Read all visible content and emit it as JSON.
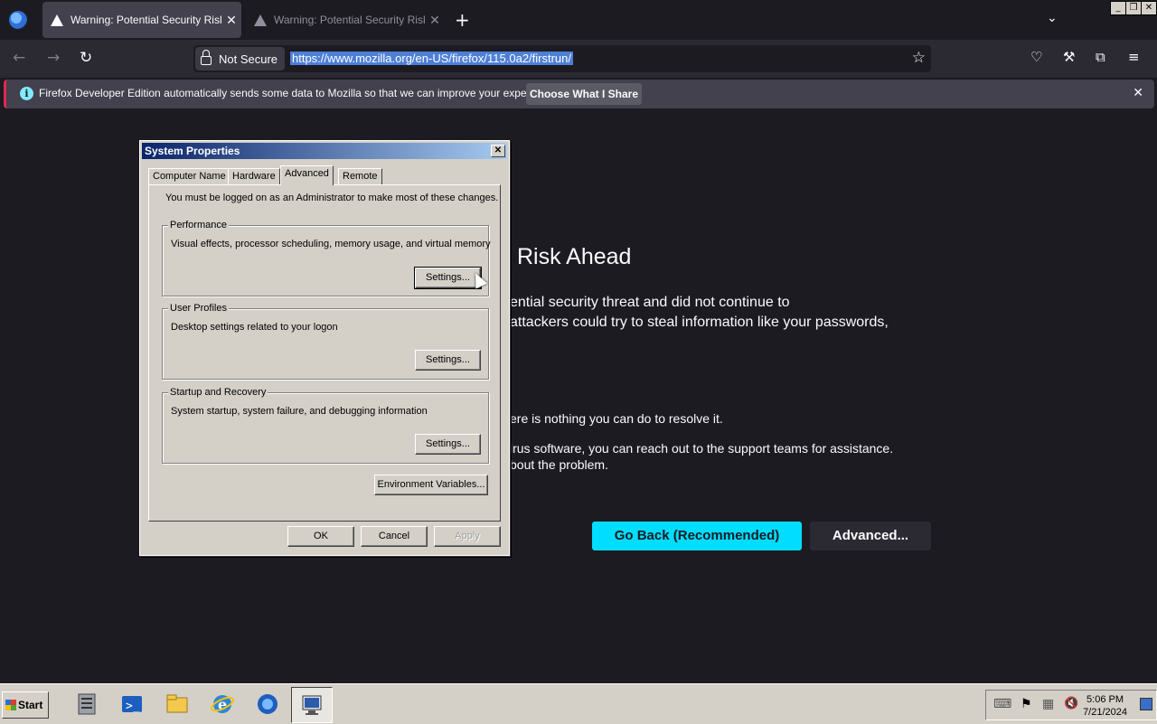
{
  "browser": {
    "tabs": [
      {
        "title": "Warning: Potential Security Risk Ah"
      },
      {
        "title": "Warning: Potential Security Risk Ah"
      }
    ],
    "security_label": "Not Secure",
    "url": "https://www.mozilla.org/en-US/firefox/115.0a2/firstrun/",
    "window_controls": {
      "minimize": "_",
      "restore": "❒",
      "close": "✕"
    }
  },
  "infobar": {
    "text": "Firefox Developer Edition automatically sends some data to Mozilla so that we can improve your experience.",
    "button": "Choose What I Share"
  },
  "page": {
    "heading": "Risk Ahead",
    "para1_line1": "ential security threat and did not continue to",
    "para1_line2": "attackers could try to steal information like your passwords,",
    "para2": "ere is nothing you can do to resolve it.",
    "para3_line1": "irus software, you can reach out to the support teams for assistance.",
    "para3_line2": "bout the problem.",
    "go_back": "Go Back (Recommended)",
    "advanced": "Advanced..."
  },
  "dialog": {
    "title": "System Properties",
    "tabs": [
      "Computer Name",
      "Hardware",
      "Advanced",
      "Remote"
    ],
    "selected_tab": "Advanced",
    "admin_note": "You must be logged on as an Administrator to make most of these changes.",
    "groups": [
      {
        "label": "Performance",
        "desc": "Visual effects, processor scheduling, memory usage, and virtual memory",
        "button": "Settings..."
      },
      {
        "label": "User Profiles",
        "desc": "Desktop settings related to your logon",
        "button": "Settings..."
      },
      {
        "label": "Startup and Recovery",
        "desc": "System startup, system failure, and debugging information",
        "button": "Settings..."
      }
    ],
    "env_button": "Environment Variables...",
    "ok": "OK",
    "cancel": "Cancel",
    "apply": "Apply"
  },
  "taskbar": {
    "start": "Start",
    "quick_launch": [
      "server-manager-icon",
      "powershell-icon",
      "explorer-icon",
      "ie-icon",
      "firefox-icon",
      "system-properties-icon"
    ],
    "time": "5:06 PM",
    "date": "7/21/2024"
  },
  "colors": {
    "accent": "#00ddff",
    "page_bg": "#1c1b22",
    "dialog_bg": "#d4d0c8",
    "title_bar": "#0a246a"
  }
}
